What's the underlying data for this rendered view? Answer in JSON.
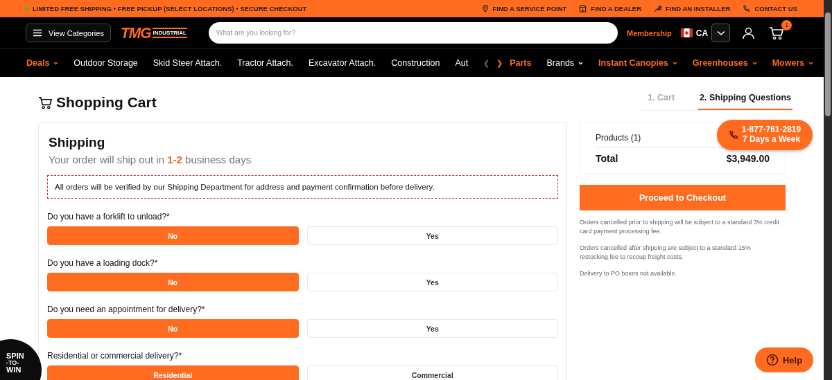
{
  "promo_bar": {
    "message": "LIMITED FREE SHIPPING • FREE PICKUP (SELECT LOCATIONS) • SECURE CHECKOUT",
    "links": [
      {
        "kind": "pin",
        "label": "FIND A SERVICE POINT"
      },
      {
        "kind": "store",
        "label": "FIND A DEALER"
      },
      {
        "kind": "wrench",
        "label": "FIND AN INSTALLER"
      },
      {
        "kind": "phone",
        "label": "CONTACT US"
      }
    ]
  },
  "header": {
    "categories_button": "View Categories",
    "logo": {
      "mark": "TMG",
      "sub": "INDUSTRIAL"
    },
    "search": {
      "placeholder": "What are you looking for?"
    },
    "membership": "Membership",
    "country": "CA",
    "cart_count": "1"
  },
  "nav": {
    "items": [
      {
        "label": "Deals",
        "accent": true,
        "dropdown": true
      },
      {
        "label": "Outdoor Storage",
        "accent": false,
        "dropdown": false
      },
      {
        "label": "Skid Steer Attach.",
        "accent": false,
        "dropdown": false
      },
      {
        "label": "Tractor Attach.",
        "accent": false,
        "dropdown": false
      },
      {
        "label": "Excavator Attach.",
        "accent": false,
        "dropdown": false
      },
      {
        "label": "Construction",
        "accent": false,
        "dropdown": false
      },
      {
        "label": "Aut",
        "accent": false,
        "dropdown": false
      }
    ],
    "prev": {
      "label": "❮",
      "disabled": true
    },
    "next": {
      "label": "❯",
      "disabled": false
    },
    "extra": [
      {
        "label": "Parts",
        "accent": true,
        "dropdown": false
      },
      {
        "label": "Brands",
        "accent": false,
        "dropdown": true
      },
      {
        "label": "Instant Canopies",
        "accent": true,
        "dropdown": true
      },
      {
        "label": "Greenhouses",
        "accent": true,
        "dropdown": true
      },
      {
        "label": "Mowers",
        "accent": true,
        "dropdown": true
      }
    ]
  },
  "page_title": "Shopping Cart",
  "steps": [
    {
      "label": "1.  Cart",
      "selected": false
    },
    {
      "label": "2.  Shipping Questions",
      "selected": true
    }
  ],
  "shipping": {
    "title": "Shipping",
    "subtitle": "Your order will ship out in **1-2** business days",
    "notice": "All orders will be verified by our Shipping Department for address and payment confirmation before delivery.",
    "questions": [
      {
        "label": "Do you have a forklift to unload?*",
        "options": [
          {
            "label": "No",
            "selected": true
          },
          {
            "label": "Yes",
            "selected": false
          }
        ]
      },
      {
        "label": "Do you have a loading dock?*",
        "options": [
          {
            "label": "No",
            "selected": true
          },
          {
            "label": "Yes",
            "selected": false
          }
        ]
      },
      {
        "label": "Do you need an appointment for delivery?*",
        "options": [
          {
            "label": "No",
            "selected": true
          },
          {
            "label": "Yes",
            "selected": false
          }
        ]
      },
      {
        "label": "Residential or commercial delivery?*",
        "options": [
          {
            "label": "Residential",
            "selected": true
          },
          {
            "label": "Commercial",
            "selected": false
          }
        ]
      }
    ]
  },
  "summary": {
    "products": "Products (1)",
    "total_label": "Total",
    "total": "$3,949.00",
    "checkout_button": "Proceed to Checkout",
    "notes": [
      "Orders cancelled prior to shipping will be subject to a standard 3% credit card payment processing fee.",
      "Orders cancelled after shipping are subject to a standard 15% restocking fee to recoup freight costs.",
      "Delivery to PO boxes not available."
    ]
  },
  "phone_bubble": {
    "number": "1-877-761-2819",
    "hours": "7 Days a Week"
  },
  "spin_badge": [
    "SPIN",
    "-TO-",
    "WIN"
  ],
  "help_button": "Help"
}
